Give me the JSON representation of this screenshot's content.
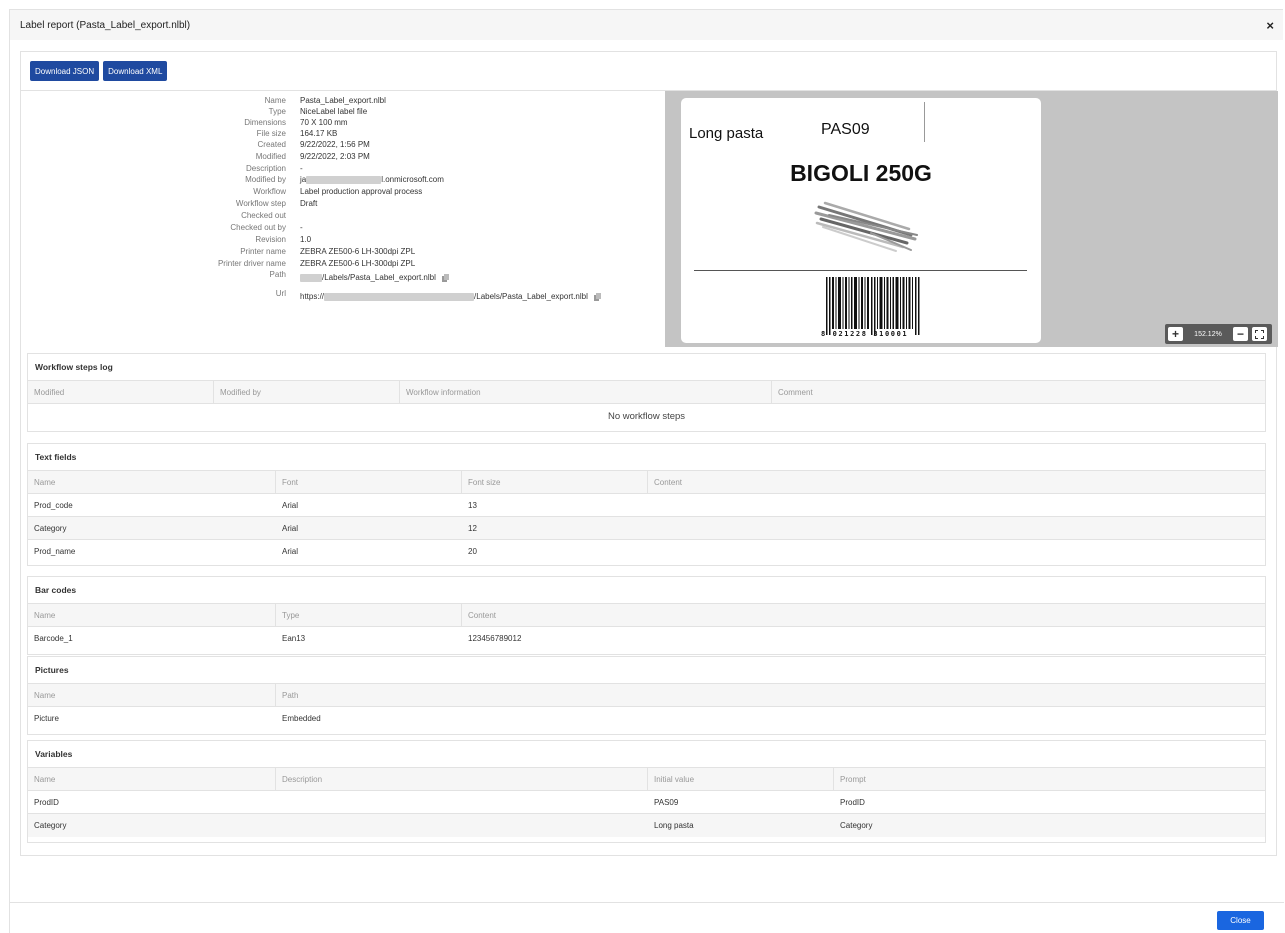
{
  "dialog": {
    "title": "Label report (Pasta_Label_export.nlbl)",
    "close_symbol": "×"
  },
  "toolbar": {
    "download_json": "Download JSON",
    "download_xml": "Download XML"
  },
  "properties": [
    {
      "label": "Name",
      "value": "Pasta_Label_export.nlbl"
    },
    {
      "label": "Type",
      "value": "NiceLabel label file"
    },
    {
      "label": "Dimensions",
      "value": "70 X 100 mm"
    },
    {
      "label": "File size",
      "value": "164.17 KB"
    },
    {
      "label": "Created",
      "value": "9/22/2022, 1:56 PM"
    },
    {
      "label": "Modified",
      "value": "9/22/2022, 2:03 PM"
    },
    {
      "label": "Description",
      "value": "-"
    },
    {
      "label": "Modified by",
      "value_prefix": "ja",
      "value_suffix": "l.onmicrosoft.com"
    },
    {
      "label": "Workflow",
      "value": "Label production approval process"
    },
    {
      "label": "Workflow step",
      "value": "Draft"
    },
    {
      "label": "Checked out",
      "value": ""
    },
    {
      "label": "Checked out by",
      "value": "-"
    },
    {
      "label": "Revision",
      "value": "1.0"
    },
    {
      "label": "Printer name",
      "value": "ZEBRA ZE500-6 LH-300dpi ZPL"
    },
    {
      "label": "Printer driver name",
      "value": "ZEBRA ZE500-6 LH-300dpi ZPL"
    },
    {
      "label": "Path",
      "value_suffix": "/Labels/Pasta_Label_export.nlbl"
    },
    {
      "label": "Url",
      "value_prefix": "https://",
      "value_suffix": "/Labels/Pasta_Label_export.nlbl"
    }
  ],
  "preview": {
    "category": "Long pasta",
    "code": "PAS09",
    "product_name": "BIGOLI 250G",
    "barcode_digits": "8 021228 310001",
    "zoom_in": "+",
    "zoom_level": "152.12%",
    "zoom_out": "−",
    "fit_icon": "fit-screen-icon"
  },
  "workflow_log": {
    "title": "Workflow steps log",
    "columns": [
      "Modified",
      "Modified by",
      "Workflow information",
      "Comment"
    ],
    "empty_text": "No workflow steps"
  },
  "text_fields": {
    "title": "Text fields",
    "columns": [
      "Name",
      "Font",
      "Font size",
      "Content"
    ],
    "rows": [
      [
        "Prod_code",
        "Arial",
        "13",
        ""
      ],
      [
        "Category",
        "Arial",
        "12",
        ""
      ],
      [
        "Prod_name",
        "Arial",
        "20",
        ""
      ]
    ]
  },
  "bar_codes": {
    "title": "Bar codes",
    "columns": [
      "Name",
      "Type",
      "Content"
    ],
    "rows": [
      [
        "Barcode_1",
        "Ean13",
        "123456789012"
      ]
    ]
  },
  "pictures": {
    "title": "Pictures",
    "columns": [
      "Name",
      "Path"
    ],
    "rows": [
      [
        "Picture",
        "Embedded"
      ]
    ]
  },
  "variables": {
    "title": "Variables",
    "columns": [
      "Name",
      "Description",
      "Initial value",
      "Prompt"
    ],
    "rows": [
      [
        "ProdID",
        "",
        "PAS09",
        "ProdID"
      ],
      [
        "Category",
        "",
        "Long pasta",
        "Category"
      ]
    ]
  },
  "footer": {
    "close_label": "Close"
  },
  "colors": {
    "primary_button": "#1a66e0",
    "toolbar_button": "#1f4aa0",
    "preview_bg": "#c4c4c4"
  }
}
